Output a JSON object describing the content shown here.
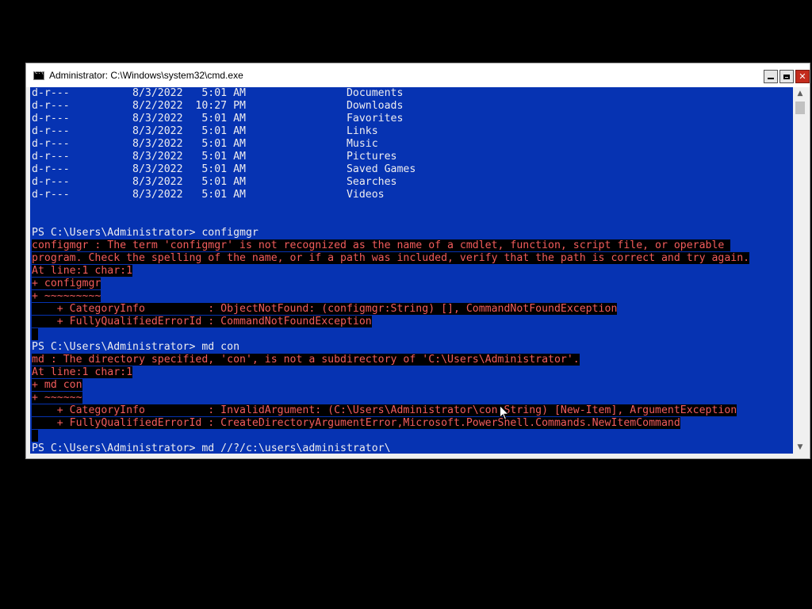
{
  "window": {
    "title": "Administrator: C:\\Windows\\system32\\cmd.exe",
    "icon": "cmd-icon",
    "controls": {
      "minimize": "minimize-icon",
      "maximize": "maximize-icon",
      "close": "close-icon"
    }
  },
  "console": {
    "background": "#0633b2",
    "text_color": "#eeedf0",
    "error_color": "#f25c5c",
    "lines": [
      {
        "text": "d-r---          8/3/2022   5:01 AM                Documents",
        "style": "normal"
      },
      {
        "text": "d-r---          8/2/2022  10:27 PM                Downloads",
        "style": "normal"
      },
      {
        "text": "d-r---          8/3/2022   5:01 AM                Favorites",
        "style": "normal"
      },
      {
        "text": "d-r---          8/3/2022   5:01 AM                Links",
        "style": "normal"
      },
      {
        "text": "d-r---          8/3/2022   5:01 AM                Music",
        "style": "normal"
      },
      {
        "text": "d-r---          8/3/2022   5:01 AM                Pictures",
        "style": "normal"
      },
      {
        "text": "d-r---          8/3/2022   5:01 AM                Saved Games",
        "style": "normal"
      },
      {
        "text": "d-r---          8/3/2022   5:01 AM                Searches",
        "style": "normal"
      },
      {
        "text": "d-r---          8/3/2022   5:01 AM                Videos",
        "style": "normal"
      },
      {
        "text": "",
        "style": "normal"
      },
      {
        "text": "",
        "style": "normal"
      },
      {
        "text": "PS C:\\Users\\Administrator> configmgr",
        "style": "normal"
      },
      {
        "text": "configmgr : The term 'configmgr' is not recognized as the name of a cmdlet, function, script file, or operable ",
        "style": "error"
      },
      {
        "text": "program. Check the spelling of the name, or if a path was included, verify that the path is correct and try again.",
        "style": "error"
      },
      {
        "text": "At line:1 char:1",
        "style": "error"
      },
      {
        "text": "+ configmgr",
        "style": "error"
      },
      {
        "text": "+ ~~~~~~~~~",
        "style": "error"
      },
      {
        "text": "    + CategoryInfo          : ObjectNotFound: (configmgr:String) [], CommandNotFoundException",
        "style": "error"
      },
      {
        "text": "    + FullyQualifiedErrorId : CommandNotFoundException",
        "style": "error"
      },
      {
        "text": " ",
        "style": "error"
      },
      {
        "text": "PS C:\\Users\\Administrator> md con",
        "style": "normal"
      },
      {
        "text": "md : The directory specified, 'con', is not a subdirectory of 'C:\\Users\\Administrator'.",
        "style": "error"
      },
      {
        "text": "At line:1 char:1",
        "style": "error"
      },
      {
        "text": "+ md con",
        "style": "error"
      },
      {
        "text": "+ ~~~~~~",
        "style": "error"
      },
      {
        "text": "    + CategoryInfo          : InvalidArgument: (C:\\Users\\Administrator\\con:String) [New-Item], ArgumentException",
        "style": "error"
      },
      {
        "text": "    + FullyQualifiedErrorId : CreateDirectoryArgumentError,Microsoft.PowerShell.Commands.NewItemCommand",
        "style": "error"
      },
      {
        "text": " ",
        "style": "error"
      },
      {
        "text": "PS C:\\Users\\Administrator> md //?/c:\\users\\administrator\\",
        "style": "normal"
      }
    ]
  },
  "scrollbar": {
    "up": "scroll-up-icon",
    "down": "scroll-down-icon"
  }
}
